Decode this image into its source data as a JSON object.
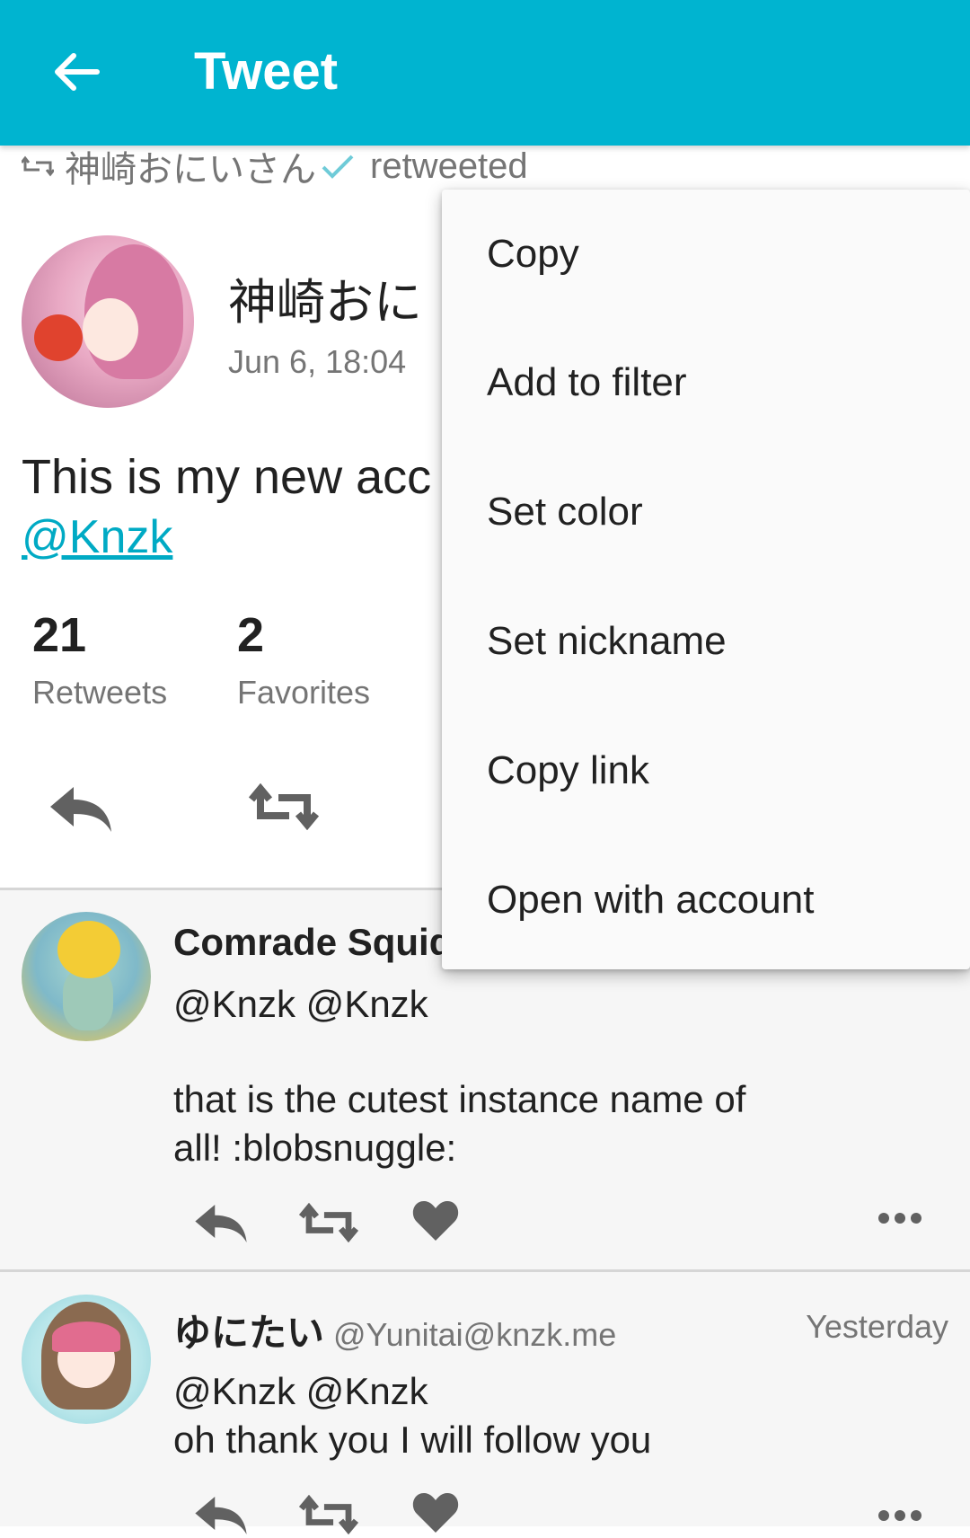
{
  "appbar": {
    "title": "Tweet",
    "back_icon": "back-arrow-icon",
    "color": "#00b4d0"
  },
  "retweet_line": {
    "name": "神崎おにいさん",
    "label": "retweeted"
  },
  "tweet": {
    "author_name_visible": "神崎おに",
    "date": "Jun 6, 18:04",
    "text_visible": "This is my new acc",
    "mention": "@Knzk",
    "retweets_count": "21",
    "retweets_label": "Retweets",
    "favorites_count": "2",
    "favorites_label": "Favorites"
  },
  "context_menu": {
    "items": [
      "Copy",
      "Add to filter",
      "Set color",
      "Set nickname",
      "Copy link",
      "Open with account"
    ]
  },
  "replies": [
    {
      "name_visible": "Comrade Squid",
      "line1": "@Knzk @Knzk",
      "text": "that is the cutest instance name of\nall! :blobsnuggle:"
    },
    {
      "name": "ゆにたい",
      "handle": "@Yunitai@knzk.me",
      "time": "Yesterday",
      "text": "@Knzk @Knzk\noh thank you I will follow you"
    }
  ],
  "colors": {
    "accent": "#00b4d0",
    "link": "#00aac4",
    "icon": "#616161"
  }
}
